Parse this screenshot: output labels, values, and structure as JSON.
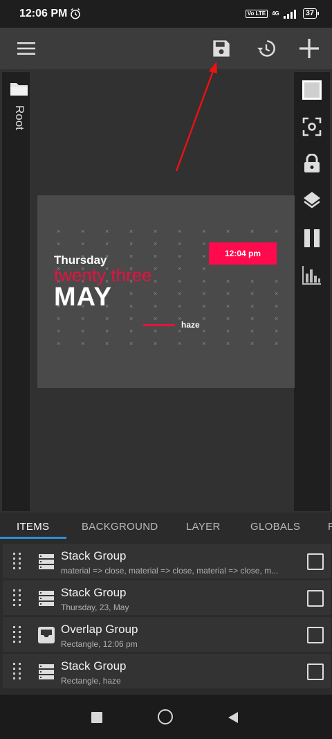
{
  "status_bar": {
    "time": "12:06 PM",
    "network_badge": "Vo LTE",
    "network_type": "4G",
    "battery": "37"
  },
  "toolbar": {
    "menu_icon": "hamburger-icon",
    "save_icon": "save-icon",
    "history_icon": "history-icon",
    "add_icon": "plus-icon"
  },
  "left_rail": {
    "folder_icon": "folder-icon",
    "label": "Root"
  },
  "right_rail": {
    "buttons": [
      "square-icon",
      "focus-icon",
      "lock-icon",
      "layers-icon",
      "pause-icon",
      "chart-icon"
    ]
  },
  "widget": {
    "day": "Thursday",
    "date_words": "twenty three",
    "month": "MAY",
    "time": "12:04 pm",
    "tag": "haze",
    "accent": "#e8113f",
    "time_box_color": "#ff0a4d"
  },
  "tabs": [
    {
      "label": "ITEMS",
      "active": true
    },
    {
      "label": "BACKGROUND",
      "active": false
    },
    {
      "label": "LAYER",
      "active": false
    },
    {
      "label": "GLOBALS",
      "active": false
    },
    {
      "label": "F",
      "active": false
    }
  ],
  "items": [
    {
      "title": "Stack Group",
      "subtitle": "material => close, material => close, material => close, m...",
      "icon": "stack-icon"
    },
    {
      "title": "Stack Group",
      "subtitle": "Thursday, 23, May",
      "icon": "stack-icon"
    },
    {
      "title": "Overlap Group",
      "subtitle": "Rectangle, 12:06 pm",
      "icon": "overlap-icon"
    },
    {
      "title": "Stack Group",
      "subtitle": "Rectangle, haze",
      "icon": "stack-icon"
    }
  ],
  "nav": [
    "recent-apps-icon",
    "home-icon",
    "back-icon"
  ]
}
